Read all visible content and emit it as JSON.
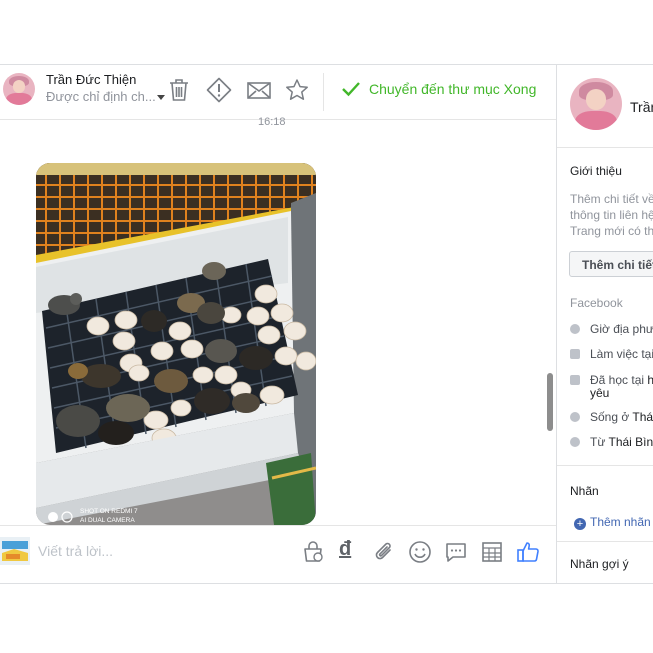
{
  "conversation": {
    "sender_name": "Trần Đức Thiện",
    "assigned": "Được chỉ định ch...",
    "move_label": "Chuyển đến thư mục Xong",
    "timestamp": "16:18",
    "photo_watermark_line1": "SHOT ON REDMI 7",
    "photo_watermark_line2": "AI DUAL CAMERA",
    "reply_placeholder": "Viết trả lời...",
    "currency_symbol": "đ"
  },
  "header_icons": [
    "trash-icon",
    "alert-icon",
    "mail-icon",
    "star-icon",
    "checkmark-icon"
  ],
  "composer_icons": [
    "bag-icon",
    "currency-icon",
    "paperclip-icon",
    "smiley-icon",
    "chat-icon",
    "table-icon",
    "like-icon"
  ],
  "profile": {
    "name": "Trần",
    "intro_title": "Giới thiệu",
    "intro_text": [
      "Thêm chi tiết về",
      "thông tin liên hệ",
      "Trang mới có th"
    ],
    "add_details_button": "Thêm chi tiết",
    "facebook_title": "Facebook",
    "details": [
      {
        "text": "Giờ địa phư",
        "strong": ""
      },
      {
        "text": "Làm việc tại",
        "strong": ""
      },
      {
        "text": "Đã học tại ",
        "strong": "h"
      },
      {
        "text": "Sống ở ",
        "strong": "Thá"
      },
      {
        "text": "Từ ",
        "strong": "Thái Bìn"
      }
    ],
    "school_line2": "yêu",
    "labels_title": "Nhãn",
    "add_label": "Thêm nhãn",
    "suggested_labels_title": "Nhãn gợi ý"
  },
  "colors": {
    "accent_green": "#42b72a",
    "link_blue": "#4267b2",
    "like_blue": "#4080ff",
    "icon_grey": "#7a7e84"
  }
}
